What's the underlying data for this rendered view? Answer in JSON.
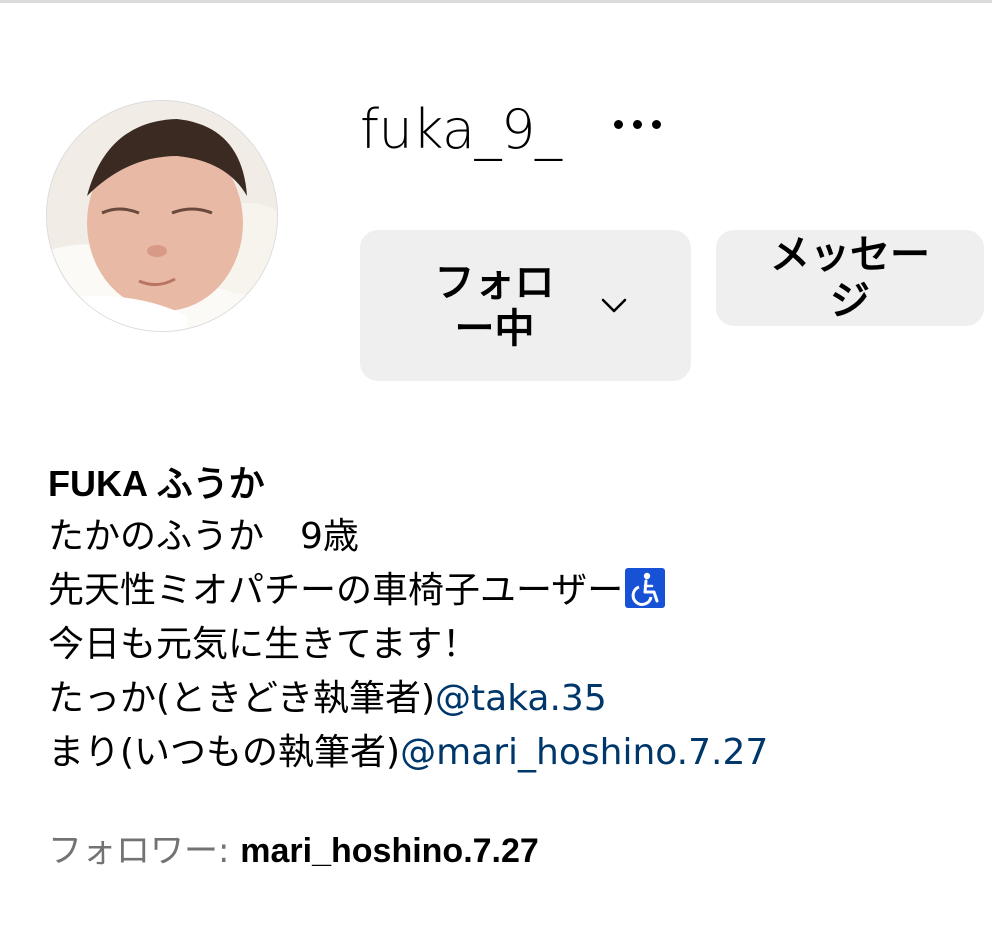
{
  "profile": {
    "username": "fuka_9_",
    "avatar_alt": "profile photo of a sleeping baby",
    "more_icon": "more-options-icon"
  },
  "actions": {
    "follow_label": "フォロー中",
    "follow_icon": "chevron-down-icon",
    "message_label": "メッセージ"
  },
  "bio": {
    "full_name": "FUKA ふうか",
    "lines": [
      "たかのふうか　9歳",
      "先天性ミオパチーの車椅子ユーザー",
      "今日も元気に生きてます！",
      "たっか(ときどき執筆者)",
      "まり(いつもの執筆者)"
    ],
    "wheelchair_icon": "wheelchair-icon",
    "mentions": [
      "@taka.35",
      "@mari_hoshino.7.27"
    ]
  },
  "followers": {
    "label": "フォロワー: ",
    "names": "mari_hoshino.7.27"
  },
  "colors": {
    "button_bg": "#efefef",
    "mention": "#00376b",
    "secondary_text": "#737373",
    "wheelchair_bg": "#1651d6"
  }
}
